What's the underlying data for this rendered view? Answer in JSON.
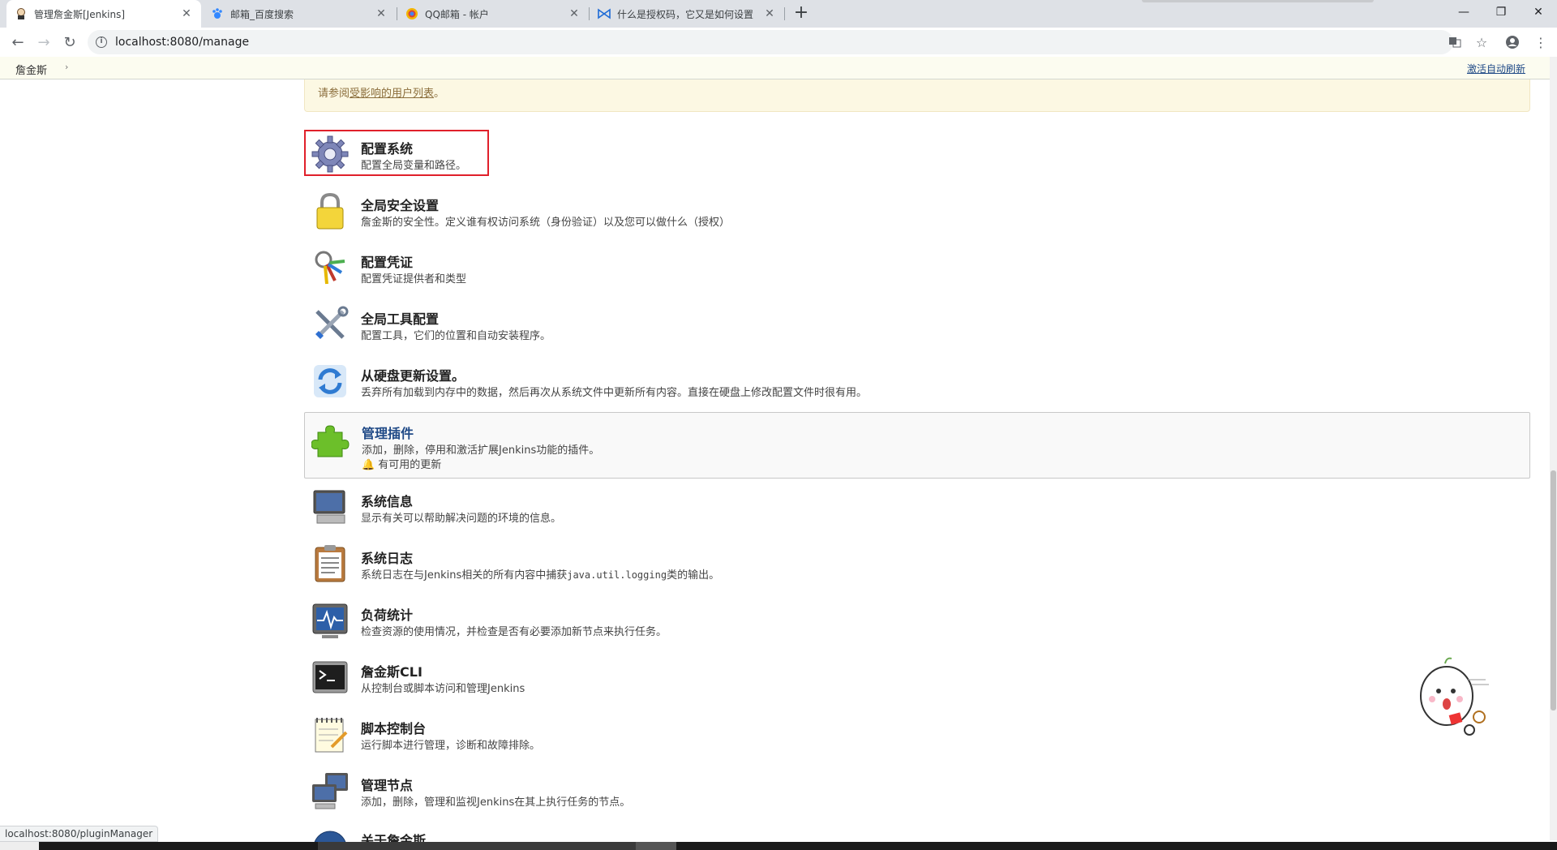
{
  "browser": {
    "tabs": [
      {
        "title": "管理詹金斯[Jenkins]",
        "active": true,
        "icon": "jenkins-icon"
      },
      {
        "title": "邮箱_百度搜索",
        "active": false,
        "icon": "baidu-paw-icon"
      },
      {
        "title": "QQ邮箱 - 帐户",
        "active": false,
        "icon": "qq-mail-icon"
      },
      {
        "title": "什么是授权码，它又是如何设置",
        "active": false,
        "icon": "bowtie-icon"
      }
    ],
    "new_tab": "+",
    "url": "localhost:8080/manage"
  },
  "breadcrumb": {
    "root": "詹金斯",
    "auto_refresh": "激活自动刷新"
  },
  "notice": {
    "prefix": "请参阅",
    "link": "受影响的用户列表",
    "suffix": "。"
  },
  "items": [
    {
      "title": "配置系统",
      "desc": "配置全局变量和路径。",
      "icon": "gear-icon"
    },
    {
      "title": "全局安全设置",
      "desc": "詹金斯的安全性。定义谁有权访问系统（身份验证）以及您可以做什么（授权）",
      "icon": "padlock-icon"
    },
    {
      "title": "配置凭证",
      "desc": "配置凭证提供者和类型",
      "icon": "keys-icon"
    },
    {
      "title": "全局工具配置",
      "desc": "配置工具，它们的位置和自动安装程序。",
      "icon": "tools-icon"
    },
    {
      "title": "从硬盘更新设置。",
      "desc": "丢弃所有加载到内存中的数据，然后再次从系统文件中更新所有内容。直接在硬盘上修改配置文件时很有用。",
      "icon": "refresh-icon"
    },
    {
      "title": "管理插件",
      "desc": "添加，删除，停用和激活扩展Jenkins功能的插件。",
      "warning": "有可用的更新",
      "icon": "puzzle-piece-icon"
    },
    {
      "title": "系统信息",
      "desc": "显示有关可以帮助解决问题的环境的信息。",
      "icon": "computer-icon"
    },
    {
      "title": "系统日志",
      "desc_prefix": "系统日志在与Jenkins相关的所有内容中捕获",
      "desc_code": "java.util.logging",
      "desc_suffix": "类的输出。",
      "icon": "clipboard-icon"
    },
    {
      "title": "负荷统计",
      "desc": "检查资源的使用情况，并检查是否有必要添加新节点来执行任务。",
      "icon": "monitor-graph-icon"
    },
    {
      "title": "詹金斯CLI",
      "desc": "从控制台或脚本访问和管理Jenkins",
      "icon": "terminal-icon"
    },
    {
      "title": "脚本控制台",
      "desc": "运行脚本进行管理，诊断和故障排除。",
      "icon": "notepad-icon"
    },
    {
      "title": "管理节点",
      "desc": "添加，删除，管理和监视Jenkins在其上执行任务的节点。",
      "icon": "computers-icon"
    },
    {
      "title": "关于詹金斯",
      "icon": "help-icon"
    }
  ],
  "status_url": "localhost:8080/pluginManager",
  "colors": {
    "link": "#204a87",
    "highlight_border": "#e0202a",
    "notice_bg": "#fcf8e3"
  }
}
